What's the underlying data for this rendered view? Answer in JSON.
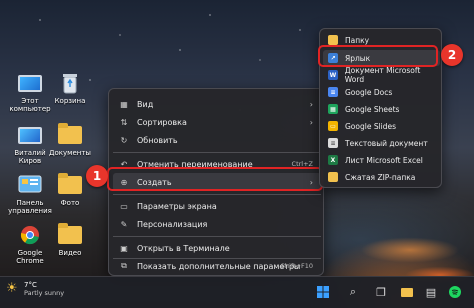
{
  "desktop": {
    "icons": [
      {
        "label": "Этот\nкомпьютер"
      },
      {
        "label": "Корзина"
      },
      {
        "label": "Виталий\nКиров"
      },
      {
        "label": "Документы"
      },
      {
        "label": "Панель\nуправления"
      },
      {
        "label": "Фото"
      },
      {
        "label": "Google\nChrome"
      },
      {
        "label": "Видео"
      }
    ]
  },
  "context_menu": {
    "items": [
      {
        "label": "Вид",
        "icon": "grid-icon",
        "submenu": true
      },
      {
        "label": "Сортировка",
        "icon": "sort-icon",
        "submenu": true
      },
      {
        "label": "Обновить",
        "icon": "refresh-icon"
      },
      {
        "label": "Отменить переименование",
        "icon": "undo-icon",
        "shortcut": "Ctrl+Z"
      },
      {
        "label": "Создать",
        "icon": "add-icon",
        "submenu": true,
        "highlighted": true
      },
      {
        "label": "Параметры экрана",
        "icon": "display-icon"
      },
      {
        "label": "Персонализация",
        "icon": "brush-icon"
      },
      {
        "label": "Открыть в Терминале",
        "icon": "terminal-icon"
      },
      {
        "label": "Показать дополнительные параметры",
        "icon": "more-icon",
        "shortcut": "Shift+F10"
      }
    ]
  },
  "submenu": {
    "items": [
      {
        "label": "Папку",
        "icon": "folder-icon",
        "color": "#f2c14e"
      },
      {
        "label": "Ярлык",
        "icon": "shortcut-icon",
        "color": "#3c7fd6",
        "highlighted": true
      },
      {
        "label": "Документ Microsoft Word",
        "icon": "word-icon",
        "color": "#2b61c4"
      },
      {
        "label": "Google Docs",
        "icon": "google-docs-icon",
        "color": "#4a86f0"
      },
      {
        "label": "Google Sheets",
        "icon": "google-sheets-icon",
        "color": "#1ea45c"
      },
      {
        "label": "Google Slides",
        "icon": "google-slides-icon",
        "color": "#f4b400"
      },
      {
        "label": "Текстовый документ",
        "icon": "text-doc-icon",
        "color": "#dcdcdc"
      },
      {
        "label": "Лист Microsoft Excel",
        "icon": "excel-icon",
        "color": "#1d7a44"
      },
      {
        "label": "Сжатая ZIP-папка",
        "icon": "zip-folder-icon",
        "color": "#f2c14e"
      }
    ]
  },
  "badges": {
    "step1": "1",
    "step2": "2"
  },
  "taskbar": {
    "weather_temp": "7°C",
    "weather_desc": "Partly sunny"
  },
  "colors": {
    "highlight_red": "#e02424",
    "badge_red": "#e8352b"
  }
}
